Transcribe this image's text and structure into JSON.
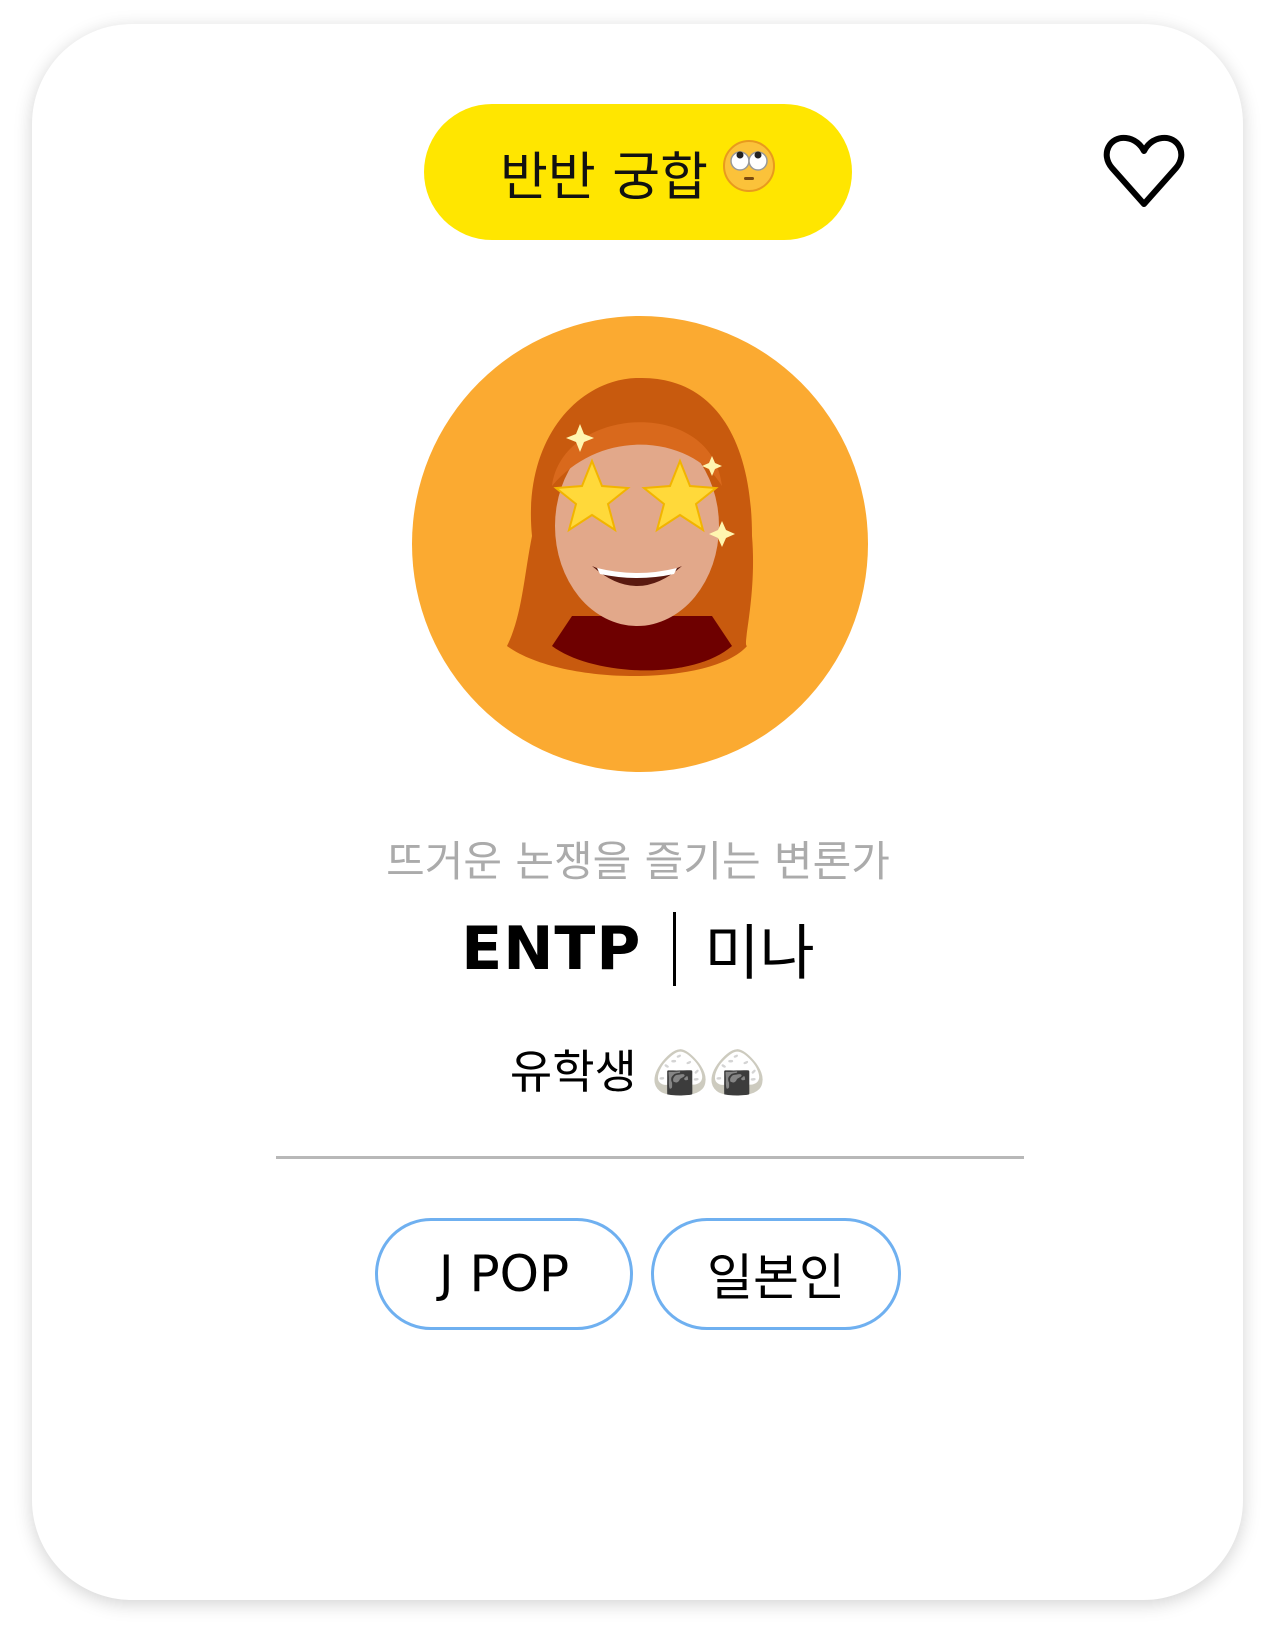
{
  "badge": {
    "label": "반반 궁합",
    "emoji": "🙄"
  },
  "favorite": {
    "icon": "heart-outline-icon"
  },
  "profile": {
    "subtitle": "뜨거운 논쟁을 즐기는 변론가",
    "mbti": "ENTP",
    "name": "미나",
    "status": "유학생",
    "status_emoji": "🍙🍙"
  },
  "tags": [
    "J POP",
    "일본인"
  ],
  "colors": {
    "badge": "#FFE600",
    "avatar_bg": "#FBAA31",
    "tag_border": "#6FB0F0",
    "subtitle": "#ababab"
  }
}
